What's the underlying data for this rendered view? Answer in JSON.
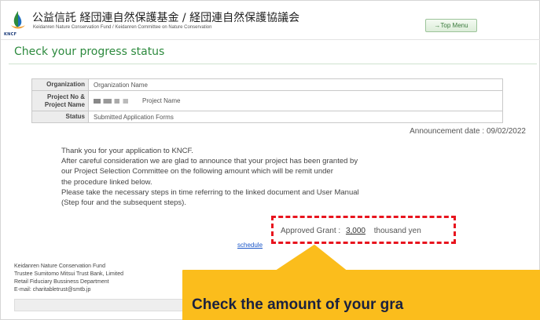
{
  "header": {
    "logo_caption": "KNCF",
    "org_name_jp": "公益信託 経団連自然保護基金 / 経団連自然保護協議会",
    "org_name_en": "Keidanren Nature Conservation Fund / Keidanren Committee on Nature Conservation",
    "top_menu_label": "→Top Menu"
  },
  "page": {
    "title": "Check your progress status"
  },
  "info_table": {
    "organization_label": "Organization",
    "organization_value": "Organization Name",
    "project_label": "Project No & Project Name",
    "project_value": "Project Name",
    "status_label": "Status",
    "status_value": "Submitted Application Forms"
  },
  "announcement": "Announcement date : 09/02/2022",
  "message": {
    "lines": [
      "Thank you for your application to KNCF.",
      "After careful consideration we are glad to announce that your project has been granted by",
      "our Project Selection Committee on the following amount which will be remit under",
      "the procedure linked below.",
      "Please take the necessary steps in time referring to the linked document and User Manual",
      "(Step four and the subsequent steps)."
    ]
  },
  "grant": {
    "label": "Approved Grant :",
    "amount": "3,000",
    "unit": "thousand yen"
  },
  "schedule_link": "schedule",
  "footer": {
    "lines": [
      "Keidanren Nature Conservation Fund",
      "Trustee Sumitomo Mitsui Trust Bank, Limited",
      "Retail Fiduciary Bussiness Department",
      "E-mail: charitabletrust@smtb.jp"
    ]
  },
  "callout": {
    "text": "Check the amount of your gra",
    "fill_color": "#fbbd1c",
    "border_color": "#e8141e"
  }
}
